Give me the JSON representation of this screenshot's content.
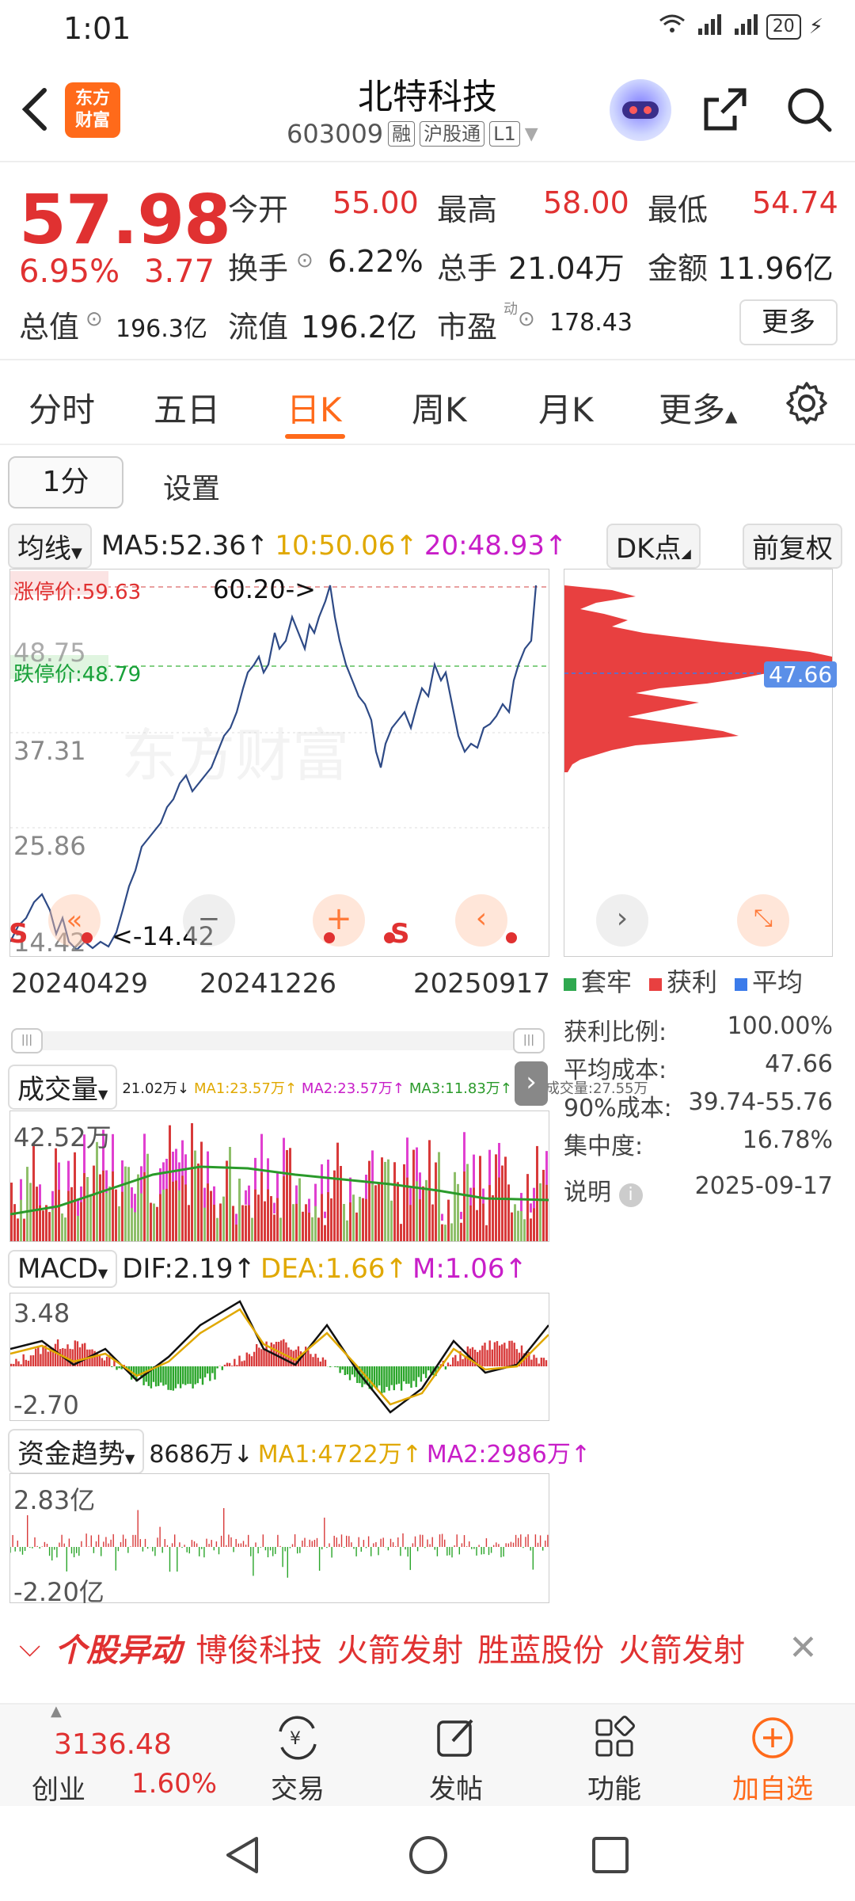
{
  "status": {
    "time": "1:01",
    "signal": "4G",
    "battery": "20"
  },
  "header": {
    "logo_line1": "东方",
    "logo_line2": "财富",
    "title": "北特科技",
    "code": "603009",
    "tags": [
      "融",
      "沪股通",
      "L1"
    ]
  },
  "quote": {
    "price": "57.98",
    "pct": "6.95%",
    "change": "3.77",
    "open_label": "今开",
    "open": "55.00",
    "high_label": "最高",
    "high": "58.00",
    "low_label": "最低",
    "low": "54.74",
    "turnover_label": "换手",
    "turnover": "6.22%",
    "volume_label": "总手",
    "volume": "21.04万",
    "amount_label": "金额",
    "amount": "11.96亿",
    "mktcap_label": "总值",
    "mktcap": "196.3亿",
    "float_label": "流值",
    "float": "196.2亿",
    "pe_label": "市盈",
    "pe_sup": "动",
    "pe": "178.43",
    "more": "更多"
  },
  "tabs": [
    "分时",
    "五日",
    "日K",
    "周K",
    "月K",
    "更多"
  ],
  "active_tab": "日K",
  "subbar": {
    "period": "1分",
    "settings": "设置"
  },
  "ma": {
    "label": "均线",
    "ma5": "MA5:52.36↑",
    "ma10": "10:50.06↑",
    "ma20": "20:48.93↑",
    "dk": "DK点",
    "adj": "前复权"
  },
  "kline": {
    "ylabels": [
      "48.75",
      "37.31",
      "25.86",
      "14.42"
    ],
    "limit_up": "涨停价:59.63",
    "limit_down": "跌停价:48.79",
    "max_annot": "60.20->",
    "min_annot": "<-14.42",
    "s_marker": "S",
    "xlabels": [
      "20240429",
      "20241226",
      "20250917"
    ],
    "chip_price": "47.66"
  },
  "chip": {
    "legend": [
      "套牢",
      "获利",
      "平均"
    ],
    "legend_colors": [
      "#2fa84f",
      "#e84040",
      "#3b7bea"
    ],
    "stats": [
      {
        "label": "获利比例:",
        "value": "100.00%"
      },
      {
        "label": "平均成本:",
        "value": "47.66"
      },
      {
        "label": "90%成本:",
        "value": "39.74-55.76"
      },
      {
        "label": "集中度:",
        "value": "16.78%"
      }
    ],
    "note": "说明",
    "date": "2025-09-17"
  },
  "volume": {
    "label": "成交量",
    "v": "21.02万↓",
    "ma1": "MA1:23.57万↑",
    "ma2": "MA2:23.57万↑",
    "ma3": "MA3:11.83万↑",
    "virt": "虚拟成交量:27.55万",
    "ymax": "42.52万"
  },
  "macd": {
    "label": "MACD",
    "dif": "DIF:2.19↑",
    "dea": "DEA:1.66↑",
    "m": "M:1.06↑",
    "ymax": "3.48",
    "ymin": "-2.70"
  },
  "fund": {
    "label": "资金趋势",
    "v": "8686万↓",
    "ma1": "MA1:4722万↑",
    "ma2": "MA2:2986万↑",
    "ymax": "2.83亿",
    "ymin": "-2.20亿"
  },
  "ticker": {
    "title": "个股异动",
    "items": [
      "博俊科技",
      "火箭发射",
      "胜蓝股份",
      "火箭发射"
    ]
  },
  "nav": {
    "index_value": "3136.48",
    "index_name": "创业",
    "index_pct": "1.60%",
    "items": [
      "交易",
      "发帖",
      "功能",
      "加自选"
    ]
  },
  "watermark": "东方财富"
}
